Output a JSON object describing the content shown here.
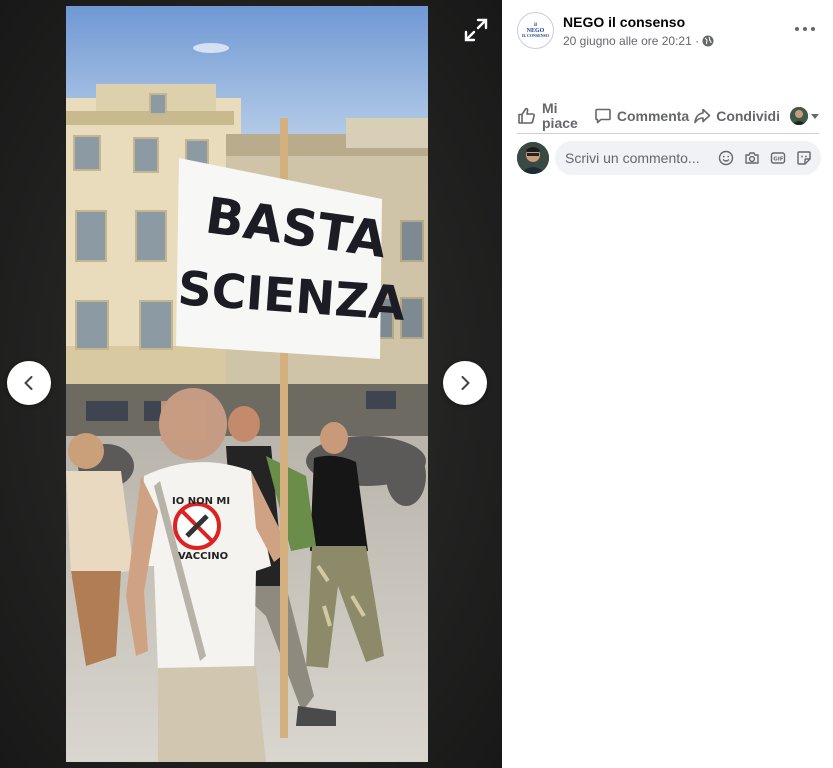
{
  "post": {
    "page_name": "NEGO il consenso",
    "timestamp": "20 giugno alle ore 20:21 ·",
    "avatar_text": [
      "il",
      "NEGO",
      "IL CONSENSO"
    ]
  },
  "actions": {
    "like_line1": "Mi",
    "like_line2": "piace",
    "comment": "Commenta",
    "share": "Condividi"
  },
  "comment_box": {
    "placeholder": "Scrivi un commento..."
  },
  "photo": {
    "sign_line1": "BASTA",
    "sign_line2": "SCIENZA",
    "shirt_line1": "IO NON MI",
    "shirt_line2": "VACCINO"
  },
  "icons": {
    "expand": "expand-icon",
    "prev": "chevron-left-icon",
    "next": "chevron-right-icon",
    "more": "more-options-icon",
    "globe": "globe-icon",
    "like": "thumbs-up-icon",
    "comment": "comment-icon",
    "share": "share-icon",
    "emoji": "emoji-icon",
    "camera": "camera-icon",
    "gif": "gif-icon",
    "sticker": "sticker-icon"
  },
  "colors": {
    "accent_text": "#65676b",
    "name_text": "#050505",
    "panel_bg": "#ffffff",
    "viewer_bg": "#1c1d1f"
  }
}
